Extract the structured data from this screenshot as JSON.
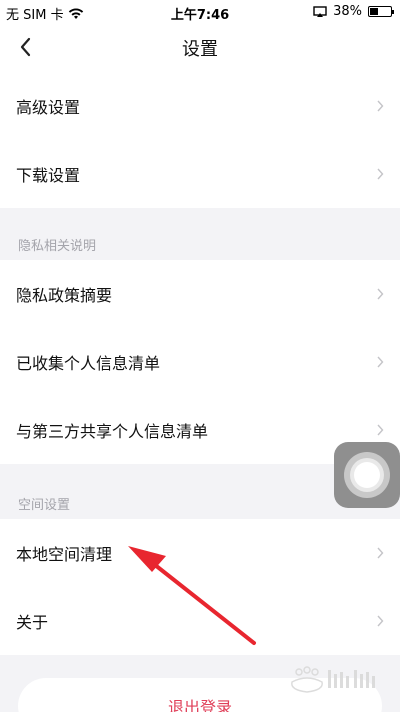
{
  "status_bar": {
    "carrier": "无 SIM 卡",
    "time": "上午7:46",
    "battery": "38%",
    "battery_level": 0.38
  },
  "nav": {
    "title": "设置"
  },
  "group1": {
    "items": [
      {
        "label": "高级设置"
      },
      {
        "label": "下载设置"
      }
    ]
  },
  "section_privacy": {
    "title": "隐私相关说明",
    "items": [
      {
        "label": "隐私政策摘要"
      },
      {
        "label": "已收集个人信息清单"
      },
      {
        "label": "与第三方共享个人信息清单"
      }
    ]
  },
  "section_space": {
    "title": "空间设置",
    "items": [
      {
        "label": "本地空间清理"
      },
      {
        "label": "关于"
      }
    ]
  },
  "logout": {
    "label": "退出登录"
  },
  "colors": {
    "logout_text": "#e0405a",
    "annotation_arrow": "#e8262f",
    "background": "#f3f3f6"
  },
  "watermark": {
    "text": "Baidu经验"
  }
}
